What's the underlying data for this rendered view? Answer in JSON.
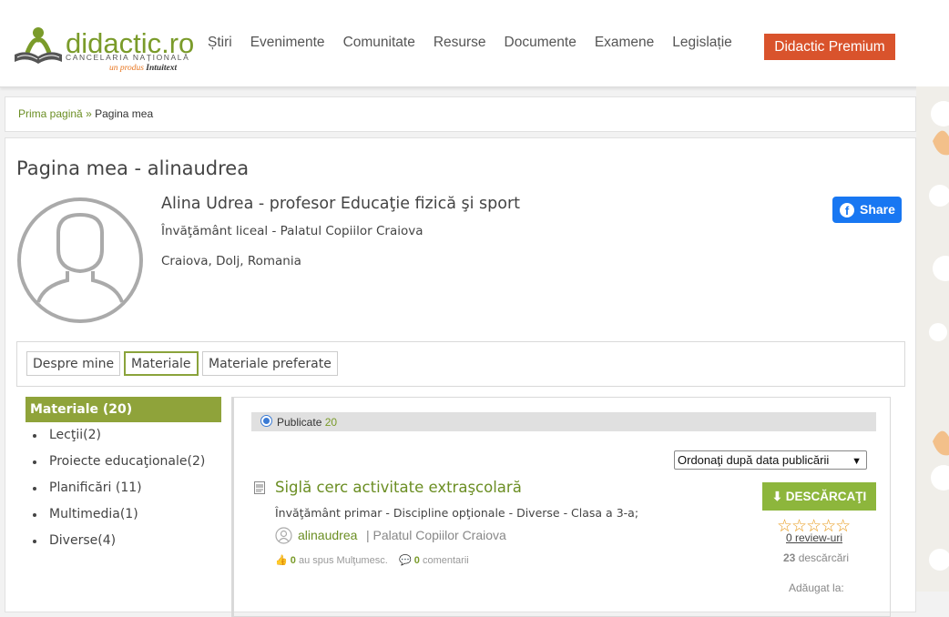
{
  "header": {
    "logo_text": "didactic.ro",
    "logo_sub": "CANCELARIA NAȚIONALĂ",
    "logo_tag_prefix": "un produs",
    "logo_tag_brand": "Intuitext",
    "nav": [
      "Știri",
      "Evenimente",
      "Comunitate",
      "Resurse",
      "Documente",
      "Examene",
      "Legislație"
    ],
    "premium": "Didactic Premium",
    "accent": "#d9532c",
    "brand_color": "#7a9b2a"
  },
  "breadcrumb": {
    "home": "Prima pagină",
    "sep": "»",
    "current": "Pagina mea"
  },
  "profile": {
    "page_title": "Pagina mea - alinaudrea",
    "name": "Alina Udrea - profesor Educaţie fizică şi sport",
    "info": "Învăţământ liceal - Palatul Copiilor Craiova",
    "location": "Craiova, Dolj, Romania",
    "share": "Share"
  },
  "tabs": [
    "Despre mine",
    "Materiale",
    "Materiale preferate"
  ],
  "sidebar": {
    "head": "Materiale (20)",
    "items": [
      "Lecţii(2)",
      "Proiecte educaţionale(2)",
      "Planificări (11)",
      "Multimedia(1)",
      "Diverse(4)"
    ]
  },
  "content": {
    "published_label": "Publicate",
    "published_count": "20",
    "sort": "Ordonaţi după data publicării",
    "material": {
      "title": "Siglă cerc activitate extraşcolară",
      "desc": "Învăţământ primar - Discipline opţionale - Diverse - Clasa a 3-a;",
      "author": "alinaudrea",
      "org": "| Palatul Copiilor Craiova",
      "thanks_count": "0",
      "thanks_label": "au spus Mulţumesc.",
      "comments_count": "0",
      "comments_label": "comentarii",
      "download": "DESCĂRCAŢI",
      "stars": "☆☆☆☆☆",
      "reviews": "0 review-uri",
      "downloads_count": "23",
      "downloads_label": "descărcări",
      "added": "Adăugat la:"
    }
  }
}
